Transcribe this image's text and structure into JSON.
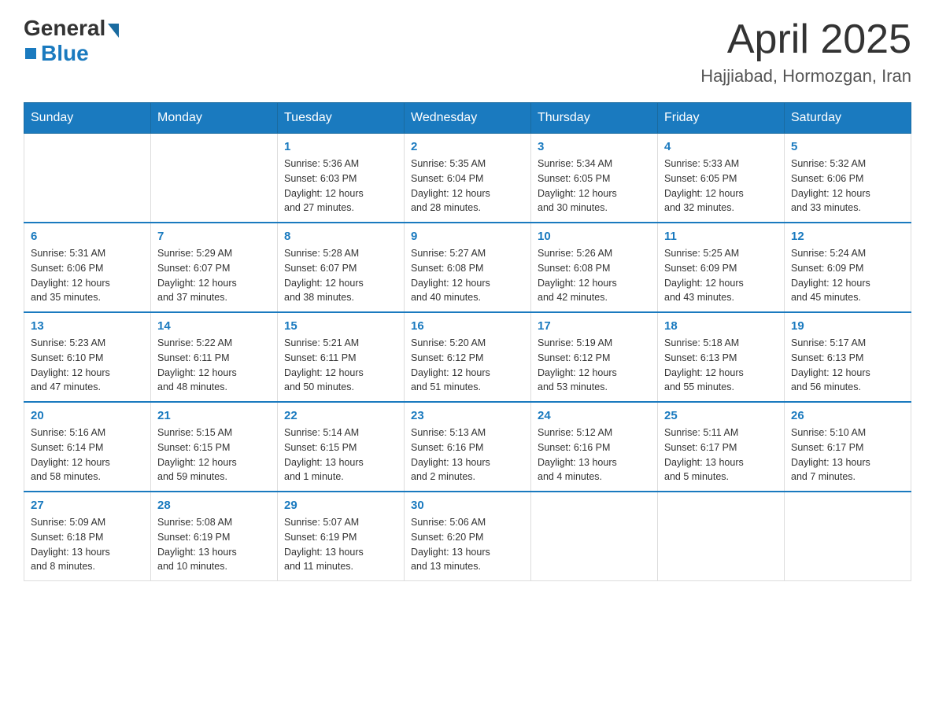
{
  "logo": {
    "general": "General",
    "blue": "Blue"
  },
  "title": "April 2025",
  "subtitle": "Hajjiabad, Hormozgan, Iran",
  "days_header": [
    "Sunday",
    "Monday",
    "Tuesday",
    "Wednesday",
    "Thursday",
    "Friday",
    "Saturday"
  ],
  "weeks": [
    [
      {
        "day": "",
        "info": ""
      },
      {
        "day": "",
        "info": ""
      },
      {
        "day": "1",
        "info": "Sunrise: 5:36 AM\nSunset: 6:03 PM\nDaylight: 12 hours\nand 27 minutes."
      },
      {
        "day": "2",
        "info": "Sunrise: 5:35 AM\nSunset: 6:04 PM\nDaylight: 12 hours\nand 28 minutes."
      },
      {
        "day": "3",
        "info": "Sunrise: 5:34 AM\nSunset: 6:05 PM\nDaylight: 12 hours\nand 30 minutes."
      },
      {
        "day": "4",
        "info": "Sunrise: 5:33 AM\nSunset: 6:05 PM\nDaylight: 12 hours\nand 32 minutes."
      },
      {
        "day": "5",
        "info": "Sunrise: 5:32 AM\nSunset: 6:06 PM\nDaylight: 12 hours\nand 33 minutes."
      }
    ],
    [
      {
        "day": "6",
        "info": "Sunrise: 5:31 AM\nSunset: 6:06 PM\nDaylight: 12 hours\nand 35 minutes."
      },
      {
        "day": "7",
        "info": "Sunrise: 5:29 AM\nSunset: 6:07 PM\nDaylight: 12 hours\nand 37 minutes."
      },
      {
        "day": "8",
        "info": "Sunrise: 5:28 AM\nSunset: 6:07 PM\nDaylight: 12 hours\nand 38 minutes."
      },
      {
        "day": "9",
        "info": "Sunrise: 5:27 AM\nSunset: 6:08 PM\nDaylight: 12 hours\nand 40 minutes."
      },
      {
        "day": "10",
        "info": "Sunrise: 5:26 AM\nSunset: 6:08 PM\nDaylight: 12 hours\nand 42 minutes."
      },
      {
        "day": "11",
        "info": "Sunrise: 5:25 AM\nSunset: 6:09 PM\nDaylight: 12 hours\nand 43 minutes."
      },
      {
        "day": "12",
        "info": "Sunrise: 5:24 AM\nSunset: 6:09 PM\nDaylight: 12 hours\nand 45 minutes."
      }
    ],
    [
      {
        "day": "13",
        "info": "Sunrise: 5:23 AM\nSunset: 6:10 PM\nDaylight: 12 hours\nand 47 minutes."
      },
      {
        "day": "14",
        "info": "Sunrise: 5:22 AM\nSunset: 6:11 PM\nDaylight: 12 hours\nand 48 minutes."
      },
      {
        "day": "15",
        "info": "Sunrise: 5:21 AM\nSunset: 6:11 PM\nDaylight: 12 hours\nand 50 minutes."
      },
      {
        "day": "16",
        "info": "Sunrise: 5:20 AM\nSunset: 6:12 PM\nDaylight: 12 hours\nand 51 minutes."
      },
      {
        "day": "17",
        "info": "Sunrise: 5:19 AM\nSunset: 6:12 PM\nDaylight: 12 hours\nand 53 minutes."
      },
      {
        "day": "18",
        "info": "Sunrise: 5:18 AM\nSunset: 6:13 PM\nDaylight: 12 hours\nand 55 minutes."
      },
      {
        "day": "19",
        "info": "Sunrise: 5:17 AM\nSunset: 6:13 PM\nDaylight: 12 hours\nand 56 minutes."
      }
    ],
    [
      {
        "day": "20",
        "info": "Sunrise: 5:16 AM\nSunset: 6:14 PM\nDaylight: 12 hours\nand 58 minutes."
      },
      {
        "day": "21",
        "info": "Sunrise: 5:15 AM\nSunset: 6:15 PM\nDaylight: 12 hours\nand 59 minutes."
      },
      {
        "day": "22",
        "info": "Sunrise: 5:14 AM\nSunset: 6:15 PM\nDaylight: 13 hours\nand 1 minute."
      },
      {
        "day": "23",
        "info": "Sunrise: 5:13 AM\nSunset: 6:16 PM\nDaylight: 13 hours\nand 2 minutes."
      },
      {
        "day": "24",
        "info": "Sunrise: 5:12 AM\nSunset: 6:16 PM\nDaylight: 13 hours\nand 4 minutes."
      },
      {
        "day": "25",
        "info": "Sunrise: 5:11 AM\nSunset: 6:17 PM\nDaylight: 13 hours\nand 5 minutes."
      },
      {
        "day": "26",
        "info": "Sunrise: 5:10 AM\nSunset: 6:17 PM\nDaylight: 13 hours\nand 7 minutes."
      }
    ],
    [
      {
        "day": "27",
        "info": "Sunrise: 5:09 AM\nSunset: 6:18 PM\nDaylight: 13 hours\nand 8 minutes."
      },
      {
        "day": "28",
        "info": "Sunrise: 5:08 AM\nSunset: 6:19 PM\nDaylight: 13 hours\nand 10 minutes."
      },
      {
        "day": "29",
        "info": "Sunrise: 5:07 AM\nSunset: 6:19 PM\nDaylight: 13 hours\nand 11 minutes."
      },
      {
        "day": "30",
        "info": "Sunrise: 5:06 AM\nSunset: 6:20 PM\nDaylight: 13 hours\nand 13 minutes."
      },
      {
        "day": "",
        "info": ""
      },
      {
        "day": "",
        "info": ""
      },
      {
        "day": "",
        "info": ""
      }
    ]
  ]
}
